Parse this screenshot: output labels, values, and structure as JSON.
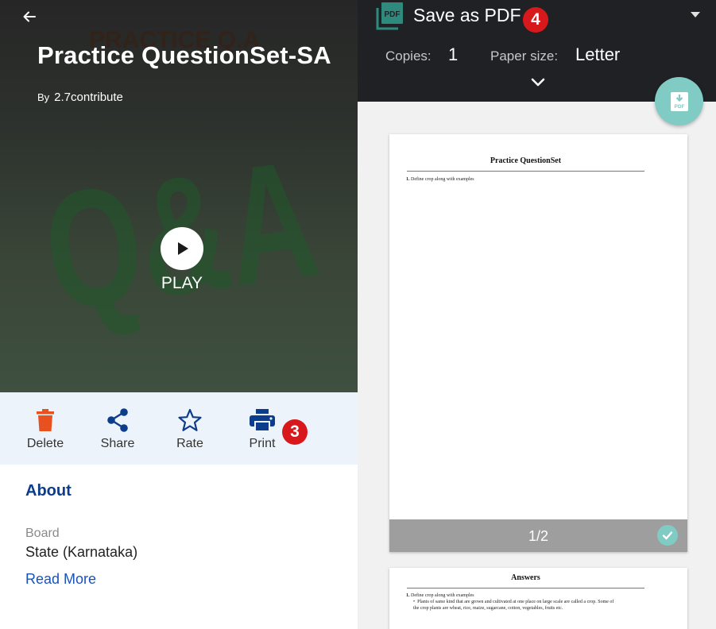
{
  "content": {
    "title": "Practice QuestionSet-SA",
    "by_prefix": "By",
    "author": "2.7contribute",
    "play_label": "PLAY",
    "art_text_top": "PRACTICE Q.A",
    "art_text_big": "Q&A"
  },
  "actions": [
    {
      "label": "Delete",
      "icon": "trash-icon",
      "color": "#e8501e"
    },
    {
      "label": "Share",
      "icon": "share-icon",
      "color": "#0c3c8c"
    },
    {
      "label": "Rate",
      "icon": "star-outline-icon",
      "color": "#0c3c8c"
    },
    {
      "label": "Print",
      "icon": "printer-icon",
      "color": "#0c3c8c"
    }
  ],
  "badges": {
    "print_step": "3",
    "pdf_step": "4",
    "color": "#d7191c"
  },
  "about": {
    "heading": "About",
    "board_label": "Board",
    "board_value": "State (Karnataka)",
    "read_more": "Read More"
  },
  "print_dialog": {
    "destination": "Save as PDF",
    "copies_label": "Copies:",
    "copies_value": "1",
    "paper_label": "Paper size:",
    "paper_value": "Letter",
    "accent": "#80cbc4"
  },
  "preview": {
    "page1_title": "Practice QuestionSet",
    "page1_q1_num": "1.",
    "page1_q1": "Define crop along with examples",
    "page_indicator": "1/2",
    "page2_title": "Answers",
    "page2_q1_num": "1.",
    "page2_q1": "Define crop along with examples",
    "page2_a1_line1": "Plants of same kind that are grown and cultivated at one place on large scale are called a crop. Some of",
    "page2_a1_line2": "the crop plants are wheat, rice, maize, sugarcane, cotton, vegetables, fruits etc."
  }
}
